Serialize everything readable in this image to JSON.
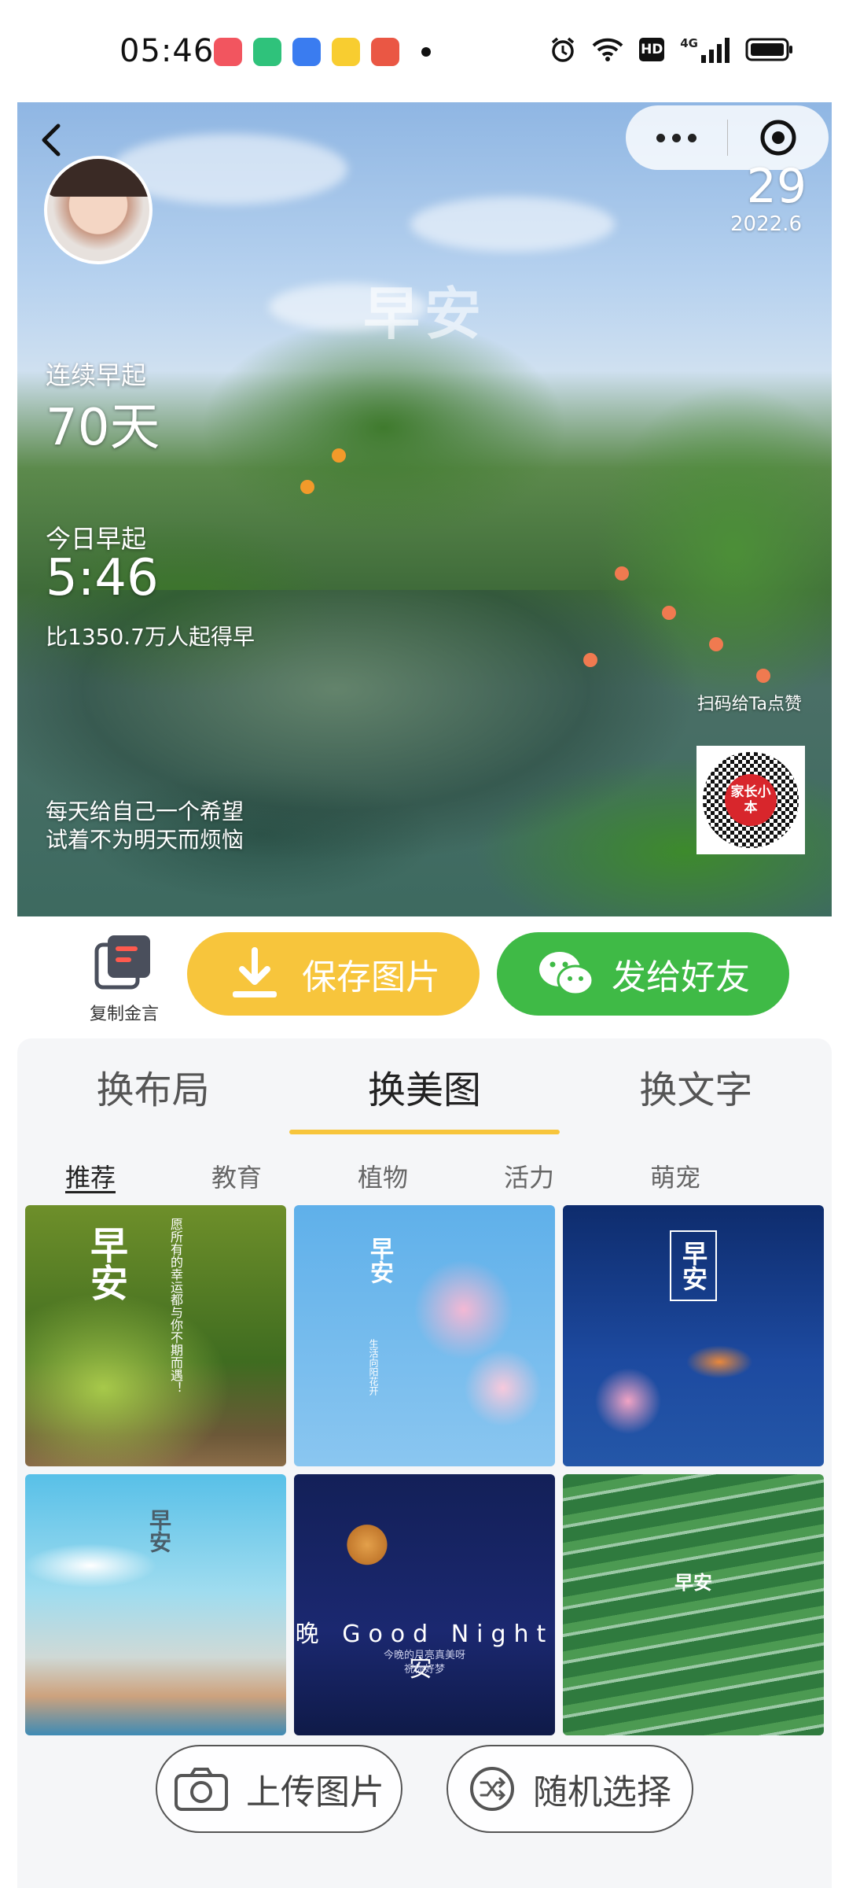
{
  "status_bar": {
    "time": "05:46",
    "app_icon_colors": [
      "#f2555f",
      "#2fc27b",
      "#3a7cf0",
      "#f8cd30",
      "#ea5744"
    ],
    "system_icons": [
      "alarm-icon",
      "wifi-icon",
      "hd-icon",
      "4g-signal-icon",
      "battery-icon"
    ],
    "hd_label": "HD",
    "network_label": "4G"
  },
  "hero": {
    "day": "29",
    "year_month": "2022.6",
    "greeting": "早安",
    "streak_label": "连续早起",
    "streak_value": "70天",
    "today_label": "今日早起",
    "today_time": "5:46",
    "rank_text": "比1350.7万人起得早",
    "quote_line1": "每天给自己一个希望",
    "quote_line2": "试着不为明天而烦恼",
    "scan_text": "扫码给Ta点赞",
    "qr_logo": "家长小本"
  },
  "actions": {
    "copy_label": "复制金言",
    "save_label": "保存图片",
    "send_label": "发给好友",
    "save_color": "#f7c53c",
    "send_color": "#3fba46"
  },
  "tabs": [
    "换布局",
    "换美图",
    "换文字"
  ],
  "active_tab": "换美图",
  "categories": [
    "推荐",
    "教育",
    "植物",
    "活力",
    "萌宠"
  ],
  "active_category": "推荐",
  "thumbnails": {
    "t1": {
      "title": "早安",
      "text": "愿所有的幸运都与你不期而遇！"
    },
    "t2": {
      "title": "早安",
      "text": "生活向阳花开"
    },
    "t3": {
      "title": "早安"
    },
    "t4": {
      "title": "早安"
    },
    "t5": {
      "title": "晚 Good Night 安",
      "text1": "今晚的月亮真美呀",
      "text2": "祝你好梦"
    },
    "t6": {
      "title": "早安"
    }
  },
  "bottom": {
    "upload_label": "上传图片",
    "random_label": "随机选择"
  }
}
